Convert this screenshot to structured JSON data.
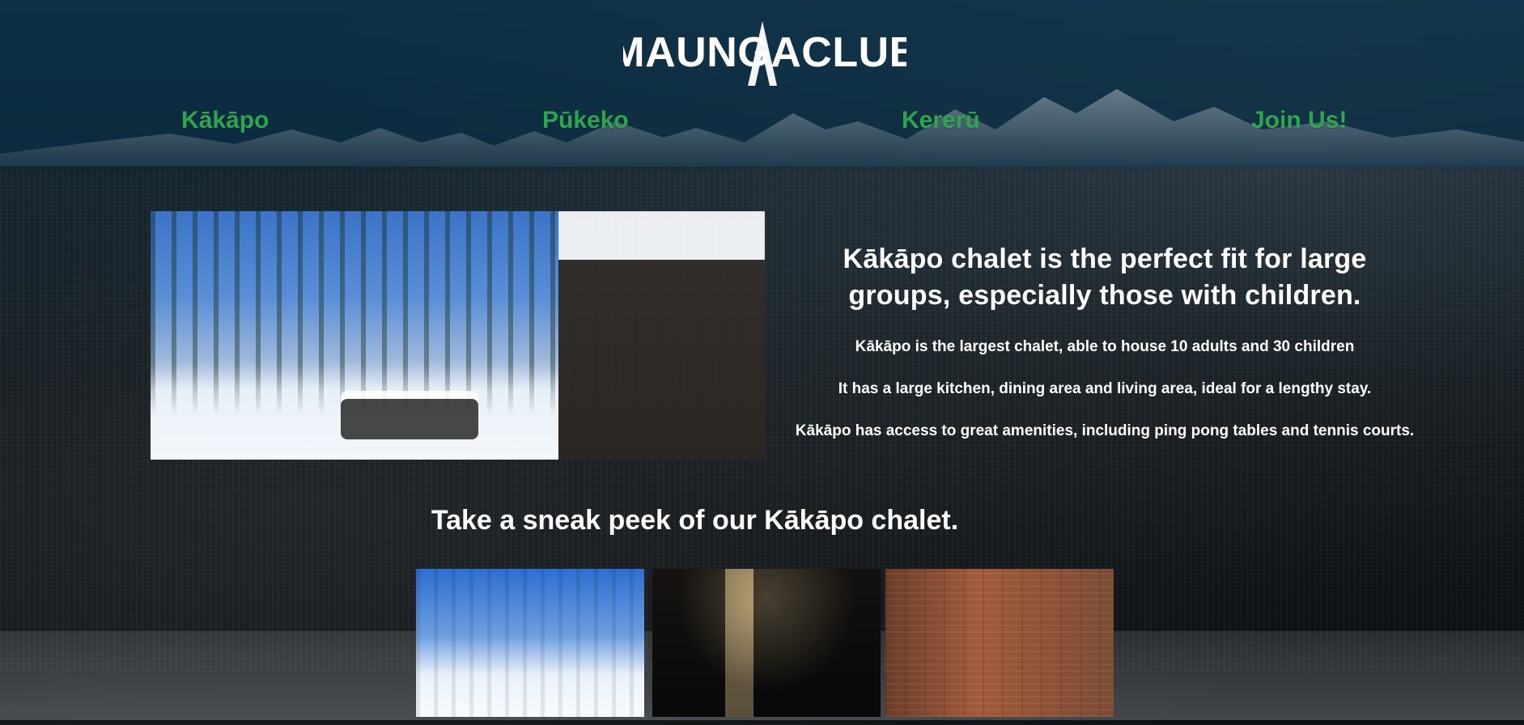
{
  "brand": {
    "logo_text": "MAUNGACLUB"
  },
  "nav": {
    "items": [
      {
        "label": "Kākāpo"
      },
      {
        "label": "Pūkeko"
      },
      {
        "label": "Kererū"
      },
      {
        "label": "Join Us!"
      }
    ]
  },
  "main": {
    "hero": {
      "title": "Kākāpo chalet is the perfect fit for large groups, especially those with children.",
      "paragraphs": [
        "Kākāpo is the largest chalet, able to house 10 adults and 30 children",
        "It has a large kitchen, dining area and living area, ideal for a lengthy stay.",
        "Kākāpo has access to great amenities, including ping pong tables and tennis courts."
      ]
    },
    "sneak_peek": {
      "title": "Take a sneak peek of our Kākāpo chalet."
    }
  },
  "theme": {
    "nav_green": "#2ea54f",
    "header_overlay": "rgba(10,45,70,0.70)",
    "text_white": "#ffffff"
  }
}
